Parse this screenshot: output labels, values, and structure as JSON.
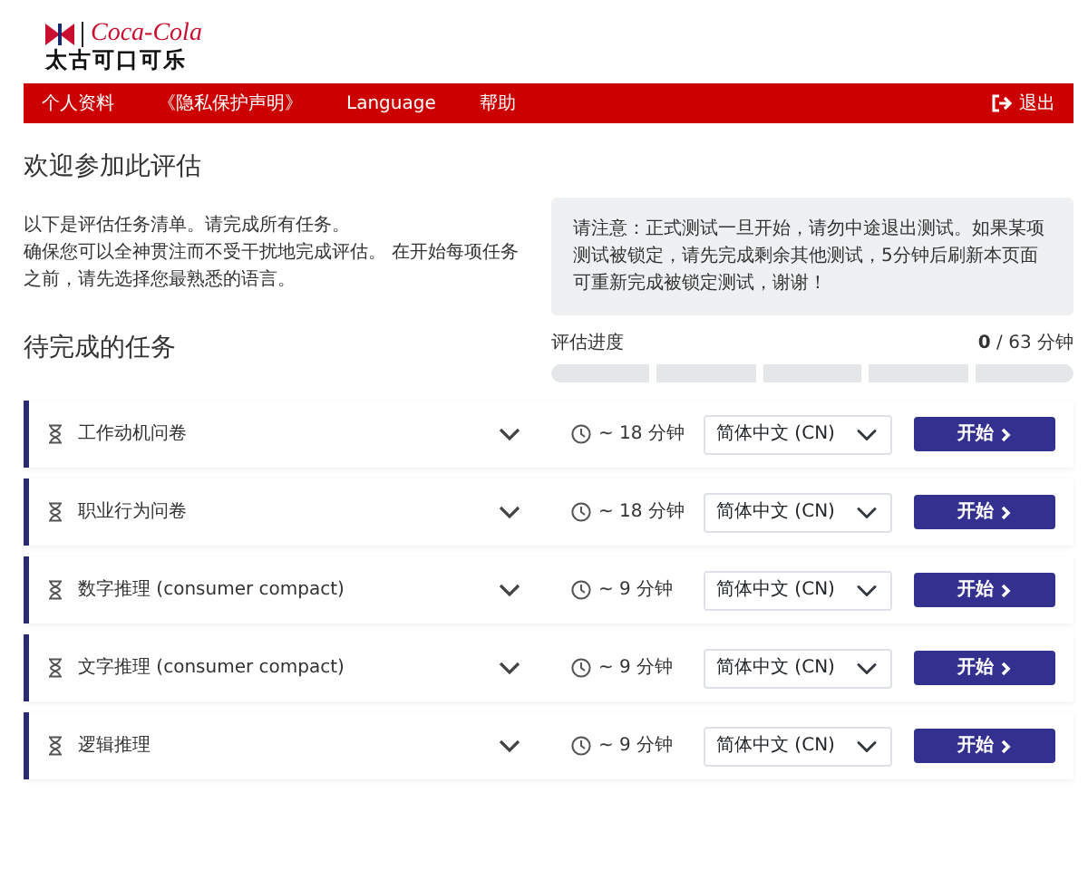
{
  "logo": {
    "brand": "Coca-Cola",
    "name": "太古可口可乐"
  },
  "nav": {
    "items": [
      "个人资料",
      "《隐私保护声明》",
      "Language",
      "帮助"
    ],
    "logout": "退出"
  },
  "welcome": {
    "title": "欢迎参加此评估",
    "paragraphs": [
      "以下是评估任务清单。请完成所有任务。",
      "确保您可以全神贯注而不受干扰地完成评估。 在开始每项任务之前，请先选择您最熟悉的语言。"
    ]
  },
  "notice": "请注意：正式测试一旦开始，请勿中途退出测试。如果某项测试被锁定，请先完成剩余其他测试，5分钟后刷新本页面可重新完成被锁定测试，谢谢！",
  "progress": {
    "label": "评估进度",
    "done": "0",
    "total": " / 63 分钟"
  },
  "tasks_title": "待完成的任务",
  "tasks": [
    {
      "name": "工作动机问卷",
      "time": "~ 18 分钟",
      "language": "简体中文 (CN)",
      "button": "开始"
    },
    {
      "name": "职业行为问卷",
      "time": "~ 18 分钟",
      "language": "简体中文 (CN)",
      "button": "开始"
    },
    {
      "name": "数字推理 (consumer compact)",
      "time": "~ 9 分钟",
      "language": "简体中文 (CN)",
      "button": "开始"
    },
    {
      "name": "文字推理 (consumer compact)",
      "time": "~ 9 分钟",
      "language": "简体中文 (CN)",
      "button": "开始"
    },
    {
      "name": "逻辑推理",
      "time": "~ 9 分钟",
      "language": "简体中文 (CN)",
      "button": "开始"
    }
  ]
}
